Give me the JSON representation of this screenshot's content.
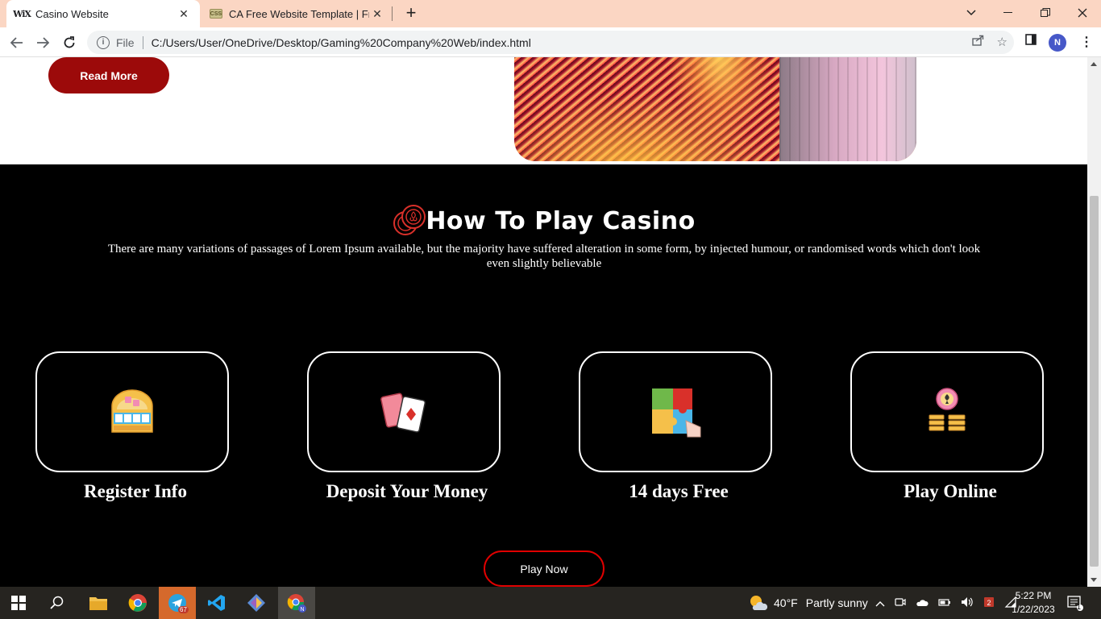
{
  "browser": {
    "tabs": [
      {
        "favicon": "WiX",
        "title": "Casino Website",
        "active": true
      },
      {
        "favicon": "CSS",
        "title": "CA Free Website Template | Free",
        "active": false
      }
    ],
    "address": {
      "scheme": "File",
      "url": "C:/Users/User/OneDrive/Desktop/Gaming%20Company%20Web/index.html"
    },
    "profile_initial": "N"
  },
  "page": {
    "hero": {
      "read_more_label": "Read More"
    },
    "how_to_play": {
      "title": "How To Play Casino",
      "description": "There are many variations of passages of Lorem Ipsum available, but the majority have suffered alteration in some form, by injected humour, or randomised words which don't look even slightly believable",
      "steps": [
        {
          "icon": "slot-machine-icon",
          "label": "Register Info"
        },
        {
          "icon": "playing-cards-icon",
          "label": "Deposit Your Money"
        },
        {
          "icon": "puzzle-icon",
          "label": "14 days Free"
        },
        {
          "icon": "poker-chips-icon",
          "label": "Play Online"
        }
      ],
      "play_now_label": "Play Now"
    }
  },
  "taskbar": {
    "telegram_badge": "67",
    "weather": {
      "temp": "40°F",
      "condition": "Partly sunny"
    },
    "clock": {
      "time": "5:22 PM",
      "date": "1/22/2023"
    },
    "notification_count": "1"
  }
}
